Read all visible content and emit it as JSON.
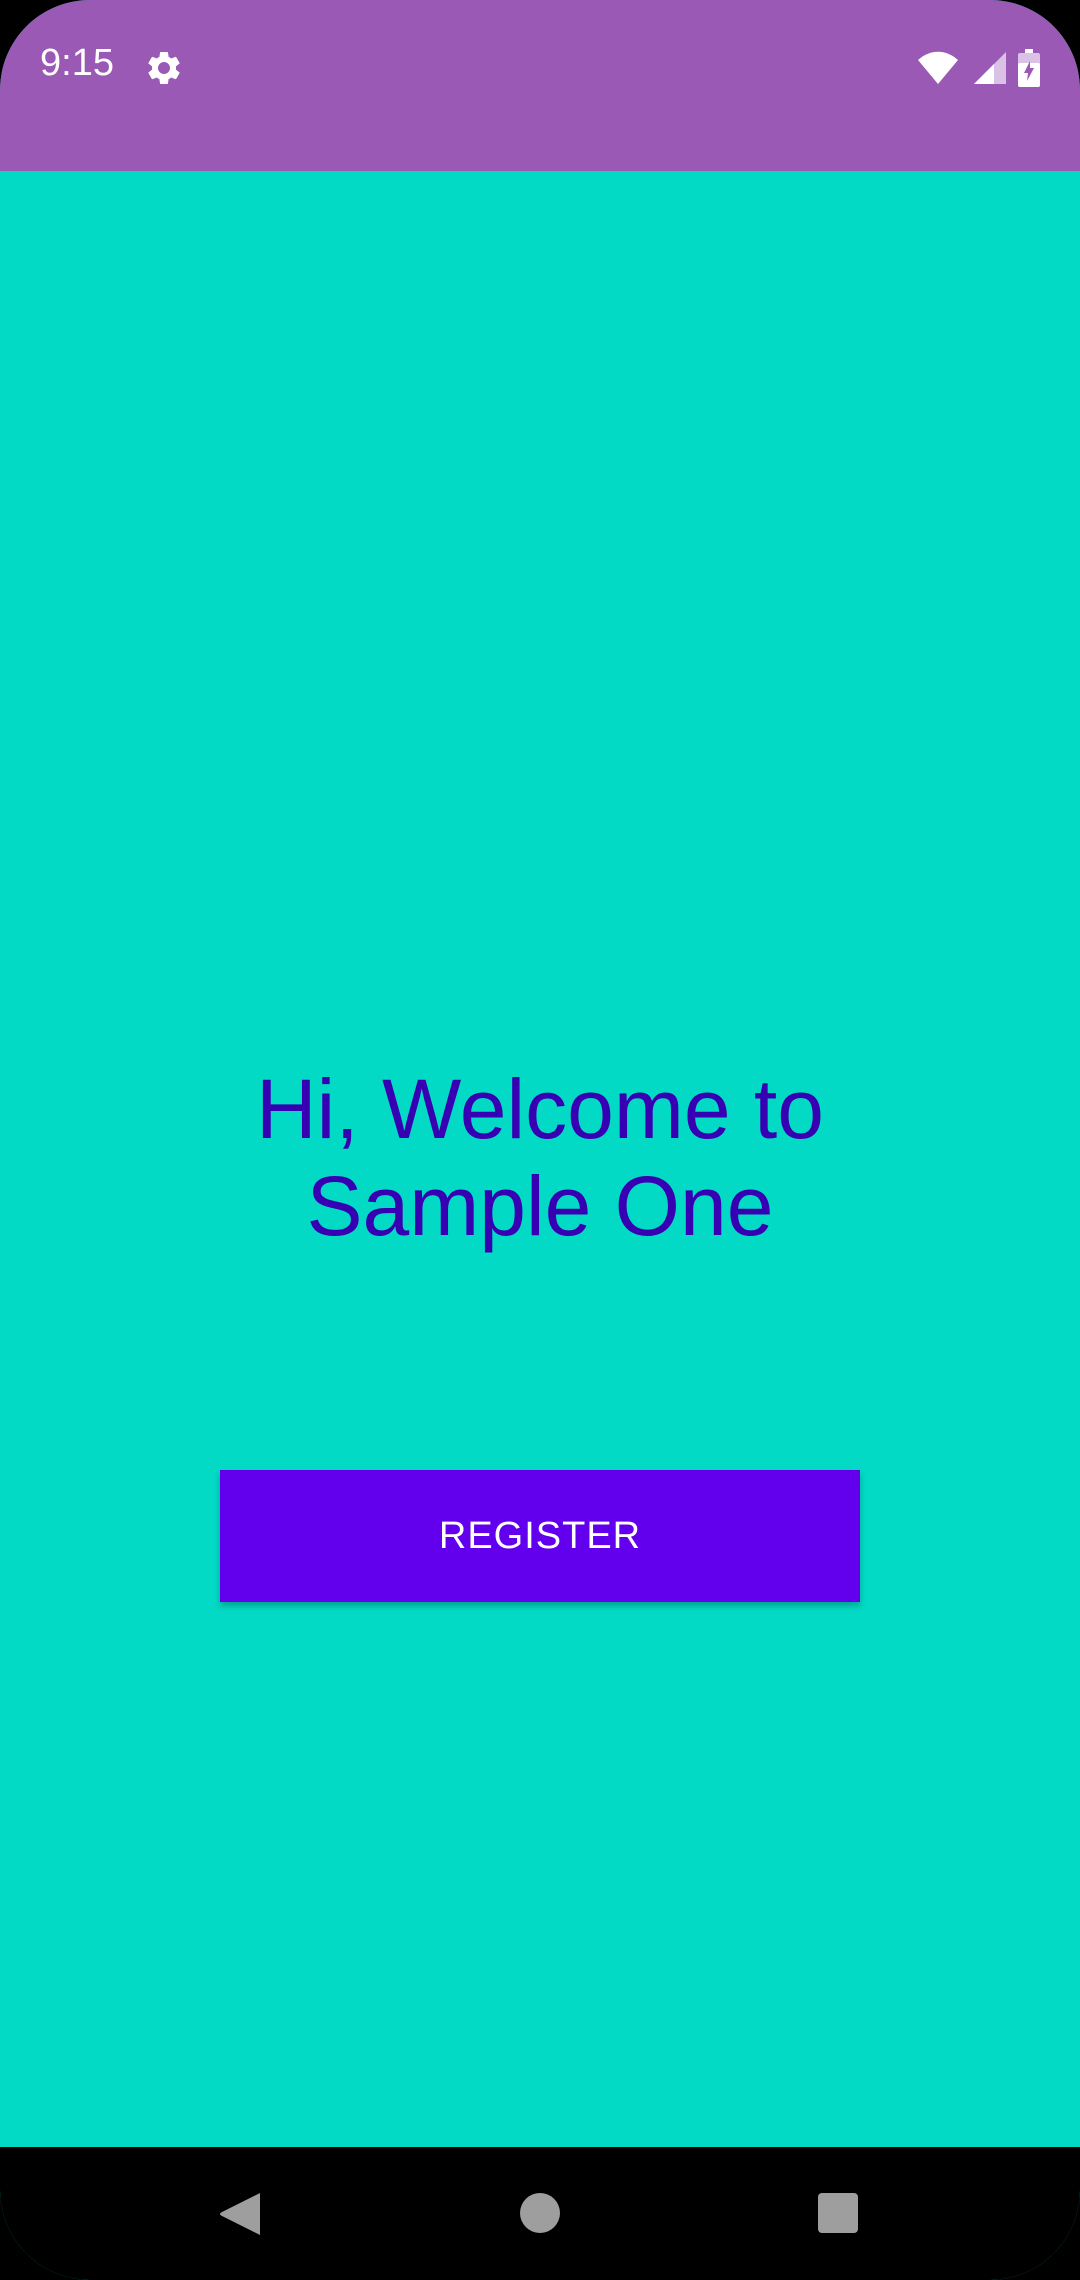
{
  "status_bar": {
    "time": "9:15",
    "icons": [
      "gear-icon",
      "wifi-icon",
      "signal-icon",
      "battery-charging-icon"
    ],
    "color": "#9b59b6"
  },
  "main": {
    "welcome_line1": "Hi, Welcome to",
    "welcome_line2": "Sample One",
    "register_label": "REGISTER",
    "background_color": "#03dac5",
    "text_color": "#3700b3",
    "button_color": "#6200ee"
  },
  "nav_bar": {
    "icons": [
      "back-icon",
      "home-icon",
      "recents-icon"
    ]
  }
}
